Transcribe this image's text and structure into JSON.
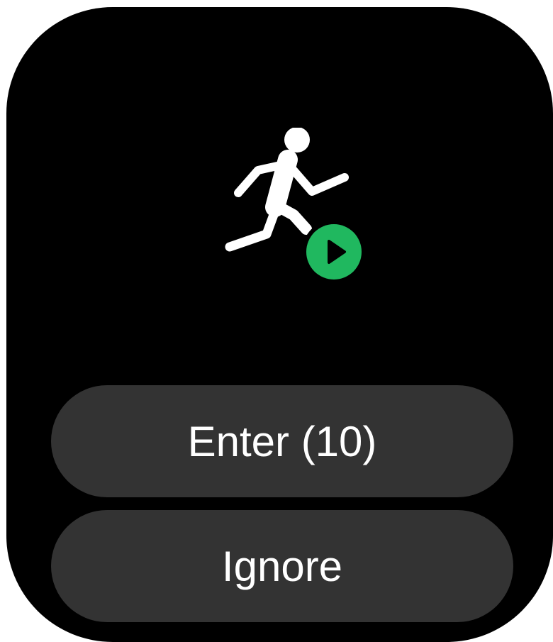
{
  "icons": {
    "workout": "running-figure-icon",
    "start": "play-circle-icon"
  },
  "colors": {
    "background": "#000000",
    "button": "#333333",
    "text": "#ffffff",
    "accent": "#20b85f"
  },
  "buttons": {
    "enter_label": "Enter (10)",
    "ignore_label": "Ignore"
  }
}
